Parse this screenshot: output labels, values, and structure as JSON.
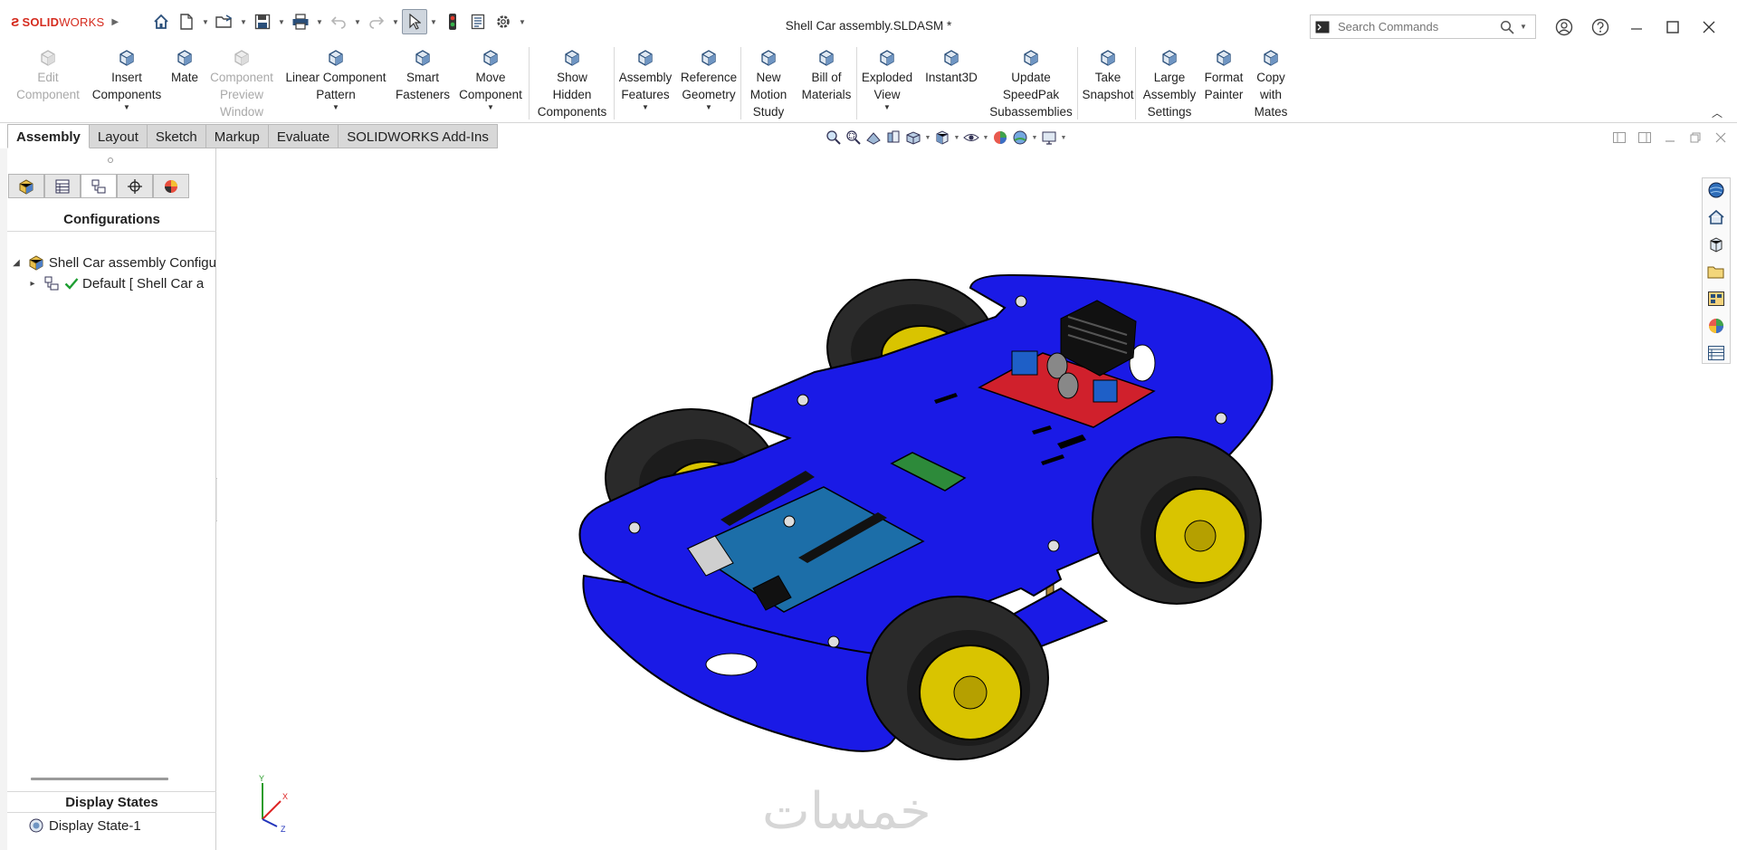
{
  "app": {
    "brand": "SOLIDWORKS",
    "window_title": "Shell Car assembly.SLDASM *"
  },
  "search": {
    "placeholder": "Search Commands"
  },
  "ribbon": {
    "buttons": [
      {
        "label": "Edit\nComponent",
        "enabled": false,
        "has_dropdown": false,
        "icon": "edit-component-icon"
      },
      {
        "label": "Insert\nComponents",
        "enabled": true,
        "has_dropdown": true,
        "icon": "insert-components-icon"
      },
      {
        "label": "Mate",
        "enabled": true,
        "has_dropdown": false,
        "icon": "mate-icon"
      },
      {
        "label": "Component\nPreview\nWindow",
        "enabled": false,
        "has_dropdown": false,
        "icon": "preview-window-icon"
      },
      {
        "label": "Linear Component\nPattern",
        "enabled": true,
        "has_dropdown": true,
        "icon": "linear-pattern-icon"
      },
      {
        "label": "Smart\nFasteners",
        "enabled": true,
        "has_dropdown": false,
        "icon": "smart-fasteners-icon"
      },
      {
        "label": "Move\nComponent",
        "enabled": true,
        "has_dropdown": true,
        "icon": "move-component-icon"
      },
      {
        "label": "Show\nHidden\nComponents",
        "enabled": true,
        "has_dropdown": false,
        "icon": "show-hidden-icon"
      },
      {
        "label": "Assembly\nFeatures",
        "enabled": true,
        "has_dropdown": true,
        "icon": "assembly-features-icon"
      },
      {
        "label": "Reference\nGeometry",
        "enabled": true,
        "has_dropdown": true,
        "icon": "reference-geometry-icon"
      },
      {
        "label": "New\nMotion\nStudy",
        "enabled": true,
        "has_dropdown": false,
        "icon": "motion-study-icon"
      },
      {
        "label": "Bill of\nMaterials",
        "enabled": true,
        "has_dropdown": false,
        "icon": "bill-of-materials-icon"
      },
      {
        "label": "Exploded\nView",
        "enabled": true,
        "has_dropdown": true,
        "icon": "exploded-view-icon"
      },
      {
        "label": "Instant3D",
        "enabled": true,
        "has_dropdown": false,
        "icon": "instant3d-icon"
      },
      {
        "label": "Update\nSpeedPak\nSubassemblies",
        "enabled": true,
        "has_dropdown": false,
        "icon": "speedpak-icon"
      },
      {
        "label": "Take\nSnapshot",
        "enabled": true,
        "has_dropdown": false,
        "icon": "camera-icon"
      },
      {
        "label": "Large\nAssembly\nSettings",
        "enabled": true,
        "has_dropdown": false,
        "icon": "large-assembly-icon"
      },
      {
        "label": "Format\nPainter",
        "enabled": true,
        "has_dropdown": false,
        "icon": "format-painter-icon"
      },
      {
        "label": "Copy\nwith\nMates",
        "enabled": true,
        "has_dropdown": false,
        "icon": "copy-with-mates-icon"
      }
    ]
  },
  "tabs": [
    {
      "label": "Assembly",
      "active": true
    },
    {
      "label": "Layout",
      "active": false
    },
    {
      "label": "Sketch",
      "active": false
    },
    {
      "label": "Markup",
      "active": false
    },
    {
      "label": "Evaluate",
      "active": false
    },
    {
      "label": "SOLIDWORKS Add-Ins",
      "active": false
    }
  ],
  "left_panel": {
    "title": "Configurations",
    "tree": [
      {
        "label": "Shell Car assembly Configu",
        "expanded": true
      },
      {
        "label": "Default [ Shell Car a",
        "expanded": false
      }
    ],
    "display_states_title": "Display States",
    "display_states": [
      {
        "label": "Display State-1"
      }
    ]
  },
  "triad": {
    "x": "X",
    "y": "Y",
    "z": "Z"
  },
  "watermark": "خمسات",
  "colors": {
    "brand_red": "#d52b1e",
    "chassis_blue": "#1a1ae6",
    "tire": "#2a2a2a",
    "rim_yellow": "#d9c400",
    "pcb_blue": "#1c6ea8"
  }
}
